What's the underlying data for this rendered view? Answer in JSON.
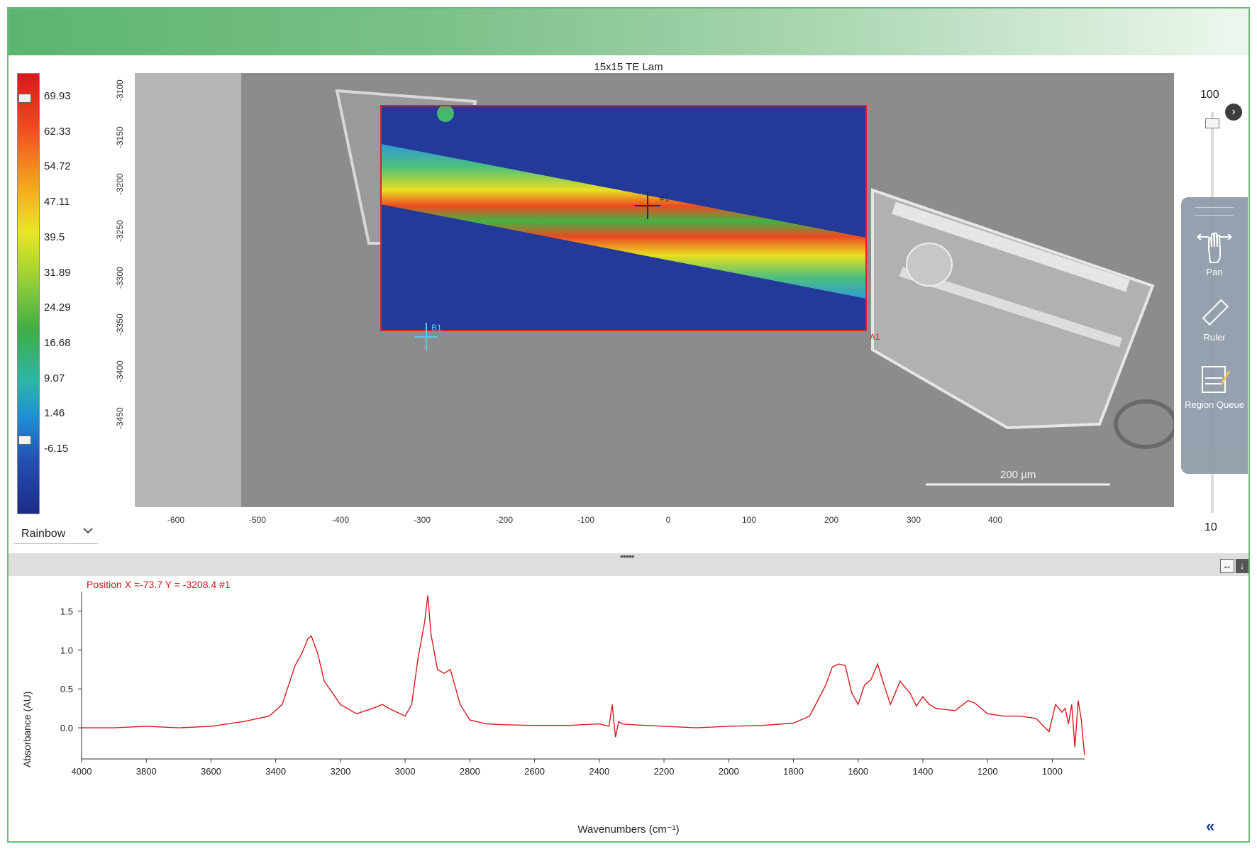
{
  "map": {
    "title": "15x15 TE Lam",
    "colorbar_ticks": [
      "69.93",
      "62.33",
      "54.72",
      "47.11",
      "39.5",
      "31.89",
      "24.29",
      "16.68",
      "9.07",
      "1.46",
      "-6.15"
    ],
    "colormap": "Rainbow",
    "y_ticks": [
      "-3100",
      "-3150",
      "-3200",
      "-3250",
      "-3300",
      "-3350",
      "-3400",
      "-3450"
    ],
    "x_ticks": [
      "-600",
      "-500",
      "-400",
      "-300",
      "-200",
      "-100",
      "0",
      "100",
      "200",
      "300",
      "400"
    ],
    "scale_bar": "200 µm",
    "markers": {
      "point": "#1",
      "corner_b": "B1",
      "corner_a": "A1"
    },
    "zoom": {
      "max": "100",
      "min": "10"
    }
  },
  "tools": {
    "pan": "Pan",
    "ruler": "Ruler",
    "region_queue": "Region Queue"
  },
  "icons": [
    "collapse-right-icon",
    "pan-hand-icon",
    "ruler-icon",
    "region-queue-icon",
    "chevron-down-icon",
    "fit-width-icon",
    "down-arrow-icon",
    "double-chevron-left-icon"
  ],
  "spectrum": {
    "position_label": "Position X =-73.7 Y = -3208.4 #1",
    "ylabel": "Absorbance (AU)",
    "xlabel": "Wavenumbers (cm⁻¹)",
    "fit_width_symbol": "↔",
    "down_symbol": "↓",
    "nav_back_symbol": "«",
    "splitter_grip": "•••••",
    "line_color": "#d71920"
  },
  "chart_data": {
    "type": "line",
    "xlabel": "Wavenumbers (cm⁻¹)",
    "ylabel": "Absorbance (AU)",
    "xlim": [
      4000,
      900
    ],
    "ylim": [
      -0.4,
      1.75
    ],
    "x_ticks": [
      4000,
      3800,
      3600,
      3400,
      3200,
      3000,
      2800,
      2600,
      2400,
      2200,
      2000,
      1800,
      1600,
      1400,
      1200,
      1000
    ],
    "y_ticks": [
      0.0,
      0.5,
      1.0,
      1.5
    ],
    "series": [
      {
        "x": [
          4000,
          3900,
          3800,
          3700,
          3600,
          3500,
          3420,
          3380,
          3340,
          3320,
          3300,
          3290,
          3270,
          3250,
          3200,
          3150,
          3100,
          3070,
          3050,
          3000,
          2980,
          2960,
          2940,
          2930,
          2920,
          2900,
          2880,
          2860,
          2850,
          2830,
          2800,
          2750,
          2700,
          2600,
          2500,
          2400,
          2370,
          2360,
          2350,
          2340,
          2330,
          2300,
          2200,
          2100,
          2000,
          1900,
          1800,
          1750,
          1700,
          1680,
          1660,
          1640,
          1620,
          1600,
          1580,
          1560,
          1540,
          1520,
          1500,
          1470,
          1455,
          1440,
          1420,
          1400,
          1380,
          1360,
          1300,
          1260,
          1240,
          1200,
          1150,
          1100,
          1050,
          1010,
          990,
          970,
          960,
          950,
          940,
          930,
          920,
          910,
          905,
          900
        ],
        "y": [
          0.0,
          0.0,
          0.02,
          0.0,
          0.02,
          0.08,
          0.15,
          0.3,
          0.8,
          0.95,
          1.15,
          1.18,
          0.95,
          0.6,
          0.3,
          0.18,
          0.25,
          0.3,
          0.25,
          0.15,
          0.3,
          0.9,
          1.35,
          1.7,
          1.2,
          0.75,
          0.7,
          0.75,
          0.6,
          0.3,
          0.1,
          0.05,
          0.04,
          0.03,
          0.03,
          0.05,
          0.02,
          0.3,
          -0.12,
          0.08,
          0.05,
          0.04,
          0.02,
          0.0,
          0.02,
          0.03,
          0.06,
          0.15,
          0.55,
          0.78,
          0.82,
          0.8,
          0.45,
          0.3,
          0.55,
          0.62,
          0.82,
          0.55,
          0.3,
          0.6,
          0.52,
          0.45,
          0.28,
          0.4,
          0.3,
          0.25,
          0.22,
          0.35,
          0.32,
          0.18,
          0.15,
          0.15,
          0.12,
          -0.05,
          0.3,
          0.2,
          0.25,
          0.05,
          0.3,
          -0.25,
          0.35,
          0.1,
          -0.15,
          -0.35
        ]
      }
    ]
  }
}
